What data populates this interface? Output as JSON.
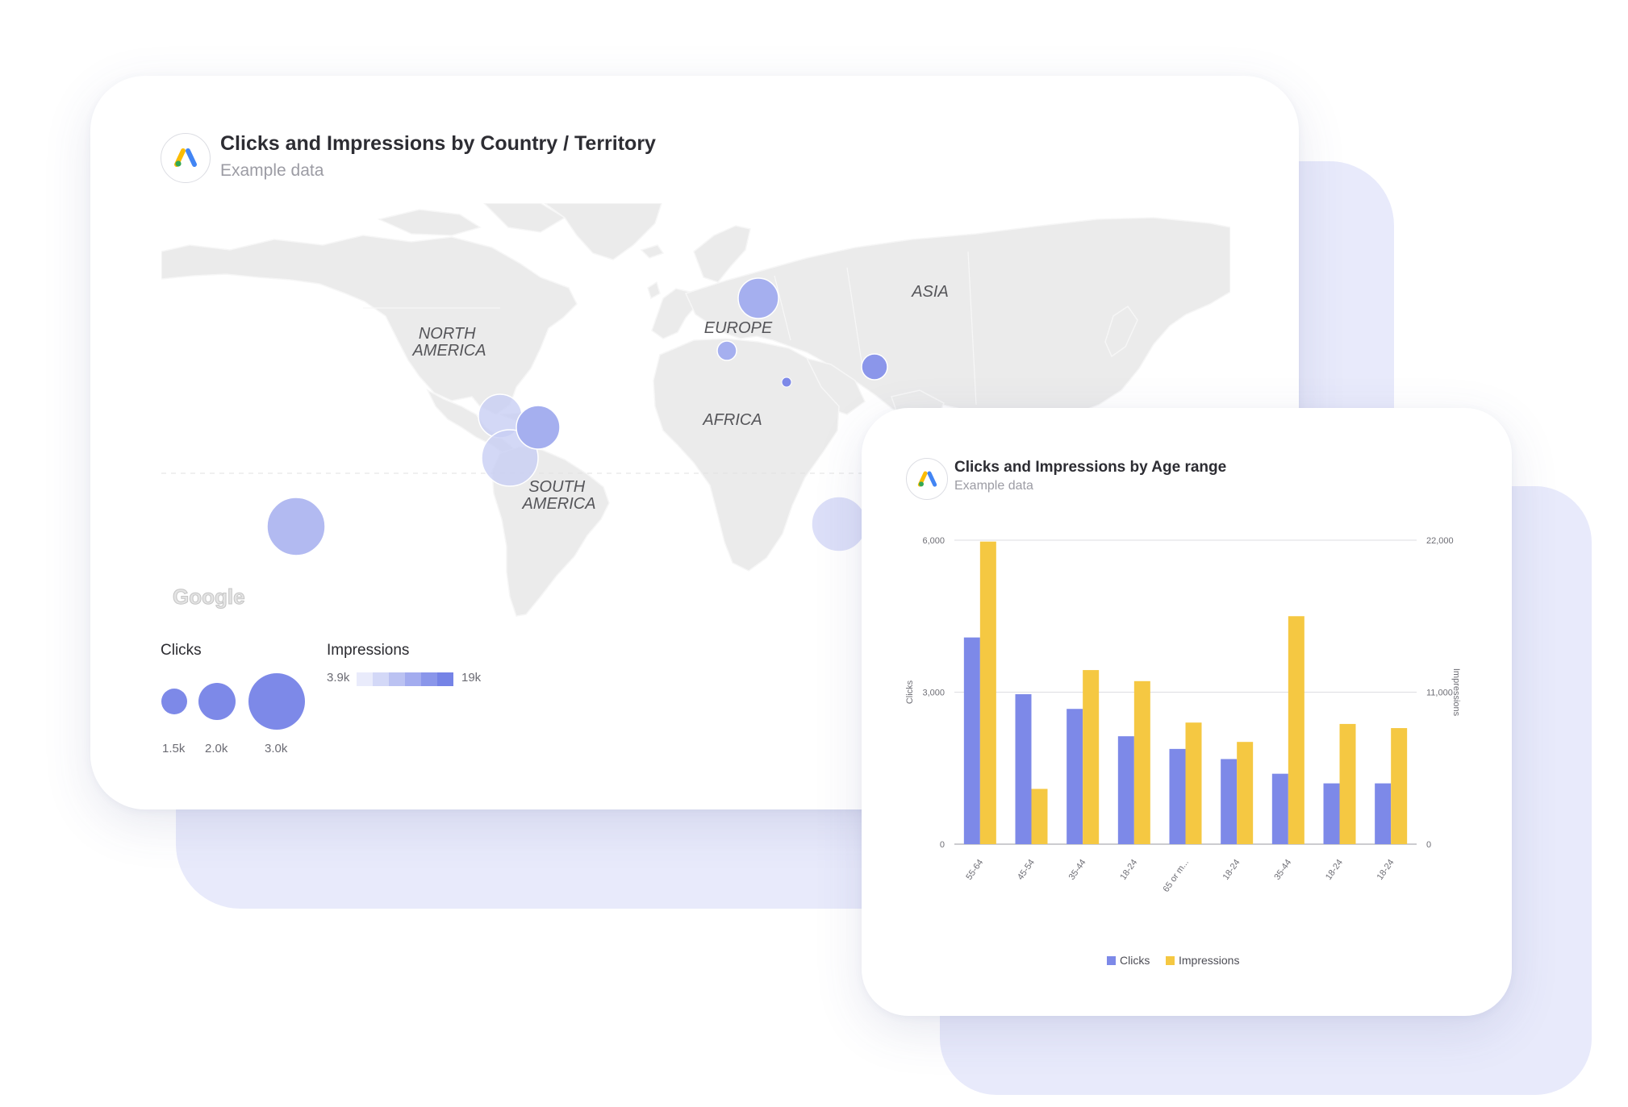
{
  "map_card": {
    "title": "Clicks and Impressions by Country / Territory",
    "subtitle": "Example data",
    "continents": [
      "NORTH AMERICA",
      "SOUTH AMERICA",
      "EUROPE",
      "AFRICA",
      "ASIA"
    ],
    "continent_labels": {
      "north_america": [
        "NORTH",
        "AMERICA"
      ],
      "south_america": [
        "SOUTH",
        "AMERICA"
      ],
      "europe": "EUROPE",
      "africa": "AFRICA",
      "asia": "ASIA"
    },
    "map_watermark": "Google",
    "legend": {
      "clicks_title": "Clicks",
      "clicks_sizes": [
        "1.5k",
        "2.0k",
        "3.0k"
      ],
      "impressions_title": "Impressions",
      "impressions_min": "3.9k",
      "impressions_max": "19k",
      "gradient_colors": [
        "#e9ebfb",
        "#d3d8f7",
        "#bbc2f2",
        "#a3acef",
        "#8a96ea",
        "#7583e6"
      ]
    }
  },
  "bar_card": {
    "title": "Clicks and Impressions by Age range",
    "subtitle": "Example data"
  },
  "chart_data": {
    "type": "bar",
    "title": "Clicks and Impressions by Age range",
    "subtitle": "Example data",
    "categories": [
      "55-64",
      "45-54",
      "35-44",
      "18-24",
      "65 or m...",
      "18-24",
      "35-44",
      "18-24",
      "18-24"
    ],
    "series": [
      {
        "name": "Clicks",
        "axis": "left",
        "color": "#7d89e8",
        "values": [
          4080,
          2960,
          2670,
          2130,
          1880,
          1680,
          1390,
          1200,
          1200
        ]
      },
      {
        "name": "Impressions",
        "axis": "right",
        "color": "#f5c842",
        "values": [
          21900,
          4000,
          12600,
          11800,
          8800,
          7400,
          16500,
          8700,
          8400
        ]
      }
    ],
    "ylabel": "Clicks",
    "y2label": "Impressions",
    "ylim": [
      0,
      6000
    ],
    "y2lim": [
      0,
      22000
    ],
    "yticks": [
      0,
      3000,
      6000
    ],
    "yticks_labels": [
      "0",
      "3,000",
      "6,000"
    ],
    "y2ticks": [
      0,
      11000,
      22000
    ],
    "y2ticks_labels": [
      "0",
      "11,000",
      "22,000"
    ],
    "grid": true,
    "legend": "bottom-center"
  }
}
